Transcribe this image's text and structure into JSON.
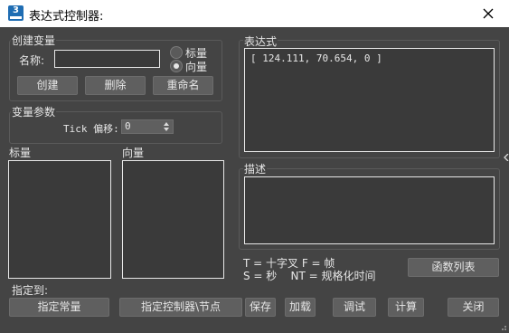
{
  "window": {
    "icon_text": "3",
    "title": "表达式控制器:"
  },
  "create_variable": {
    "group_label": "创建变量",
    "name_label": "名称:",
    "name_value": "",
    "radio_scalar": "标量",
    "radio_vector": "向量",
    "selected": "向量",
    "create_btn": "创建",
    "delete_btn": "删除",
    "rename_btn": "重命名"
  },
  "variable_params": {
    "group_label": "变量参数",
    "tick_offset_label": "Tick 偏移:",
    "tick_offset_value": "0"
  },
  "lists": {
    "scalars_label": "标量",
    "vectors_label": "向量"
  },
  "expression": {
    "label": "表达式",
    "value": "[ 124.111, 70.654, 0 ]"
  },
  "description": {
    "label": "描述",
    "value": ""
  },
  "legend": {
    "line1": "T = 十字叉 F = 帧",
    "line2": "S = 秒    NT = 规格化时间"
  },
  "buttons": {
    "function_list": "函数列表",
    "assign_to": "指定到:",
    "assign_constant": "指定常量",
    "assign_controller": "指定控制器\\节点",
    "save": "保存",
    "load": "加载",
    "debug": "调试",
    "evaluate": "计算",
    "close": "关闭"
  }
}
